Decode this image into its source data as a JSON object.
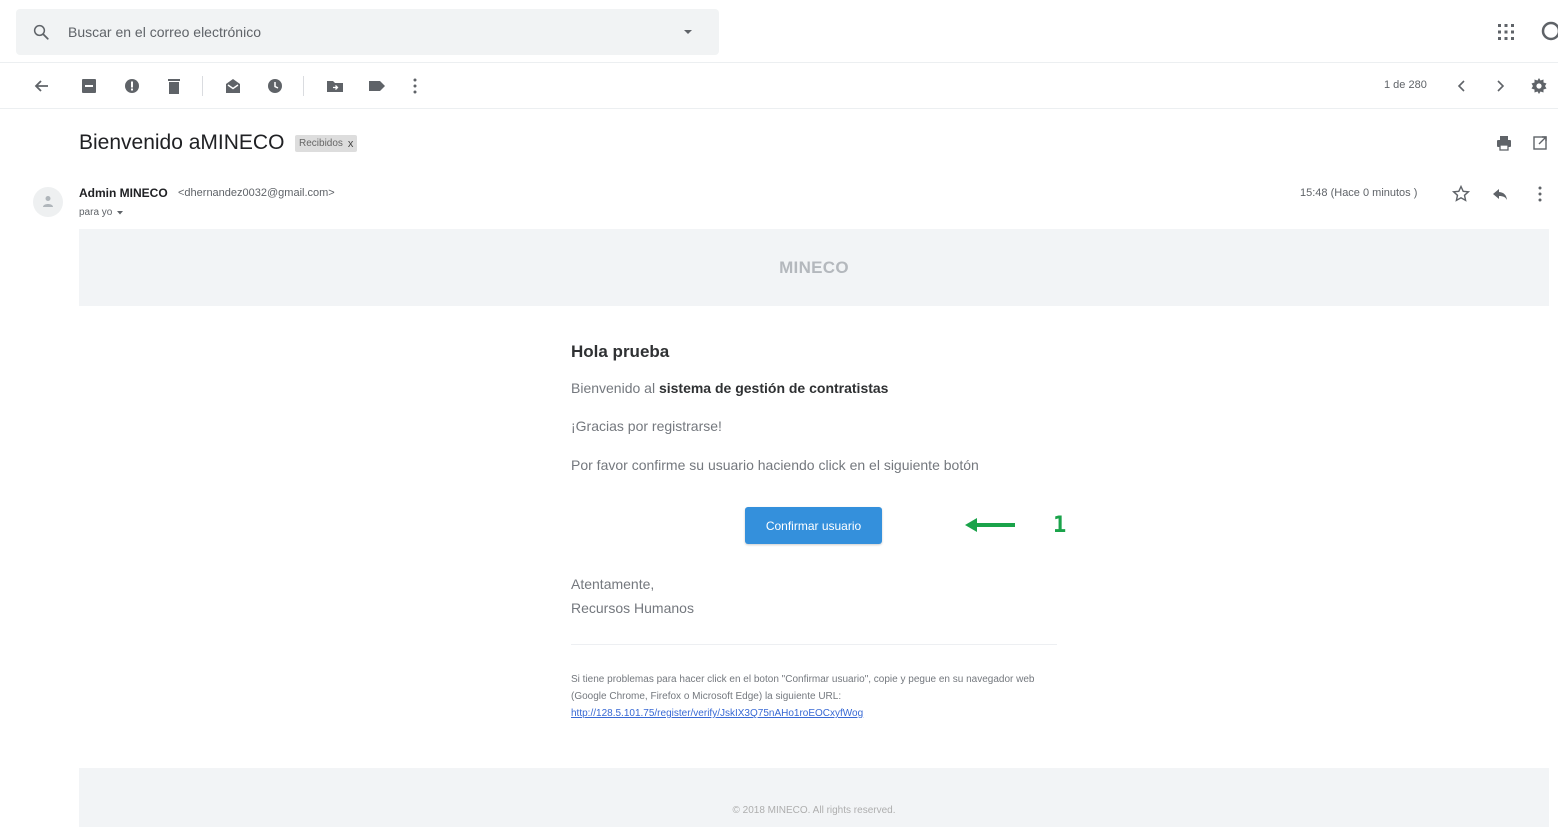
{
  "search": {
    "placeholder": "Buscar en el correo electrónico"
  },
  "toolbar": {
    "pagination": "1 de 280"
  },
  "message": {
    "subject": "Bienvenido aMINECO",
    "label": "Recibidos",
    "label_close": "x",
    "sender_name": "Admin MINECO",
    "sender_email": "<dhernandez0032@gmail.com>",
    "recipient": "para yo",
    "time": "15:48 (Hace 0 minutos )"
  },
  "email": {
    "brand": "MINECO",
    "greeting": "Hola prueba",
    "welcome_prefix": "Bienvenido al ",
    "welcome_bold": "sistema de gestión de contratistas",
    "thanks": "¡Gracias por registrarse!",
    "instruction": "Por favor confirme su usuario haciendo click en el siguiente botón",
    "button_label": "Confirmar usuario",
    "closing": "Atentamente,",
    "signature": "Recursos Humanos",
    "subcopy_text": "Si tiene problemas para hacer click en el boton \"Confirmar usuario\", copie y pegue en su navegador web (Google Chrome, Firefox o Microsoft Edge) la siguiente URL:",
    "subcopy_link": "http://128.5.101.75/register/verify/JskIX3Q75nAHo1roEOCxyfWog",
    "footer": "© 2018 MINECO. All rights reserved."
  },
  "annotation": {
    "number": "1",
    "color": "#1aa34a"
  },
  "colors": {
    "button": "#3490dc",
    "link": "#3869d4"
  }
}
